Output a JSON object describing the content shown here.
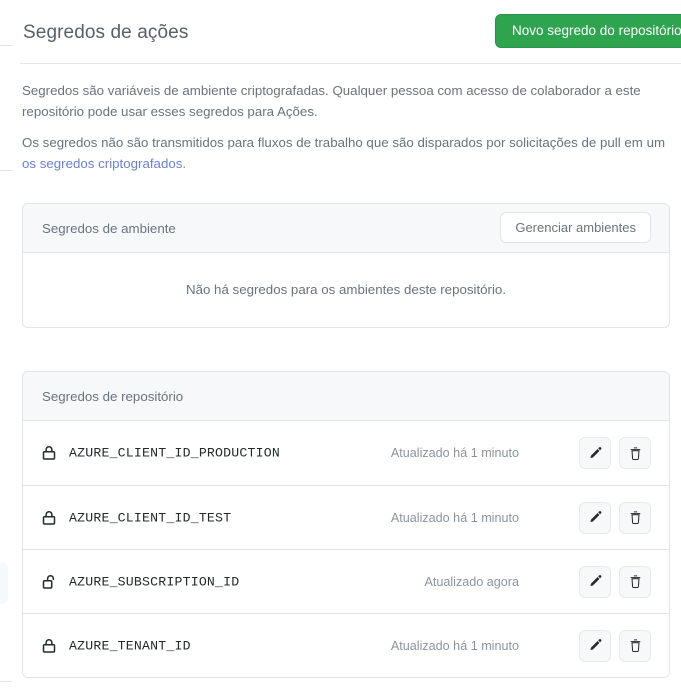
{
  "header": {
    "title": "Segredos de ações",
    "new_secret_button": "Novo segredo do repositório"
  },
  "description": {
    "paragraph1": "Segredos são variáveis de ambiente criptografadas. Qualquer pessoa com acesso de colaborador a este repositório pode usar esses segredos para Ações.",
    "paragraph2": "Os segredos não são transmitidos para fluxos de trabalho que são disparados por solicitações de pull em um ",
    "link_text": "os segredos criptografados."
  },
  "environment_secrets": {
    "title": "Segredos de ambiente",
    "manage_button": "Gerenciar ambientes",
    "empty_message": "Não há segredos para os ambientes deste repositório."
  },
  "repository_secrets": {
    "title": "Segredos de repositório",
    "rows": [
      {
        "icon": "lock-closed-icon",
        "name": "AZURE_CLIENT_ID_PRODUCTION",
        "updated": "Atualizado há 1 minuto"
      },
      {
        "icon": "lock-closed-icon",
        "name": "AZURE_CLIENT_ID_TEST",
        "updated": "Atualizado há 1 minuto"
      },
      {
        "icon": "lock-open-icon",
        "name": "AZURE_SUBSCRIPTION_ID",
        "updated": "Atualizado agora"
      },
      {
        "icon": "lock-closed-icon",
        "name": "AZURE_TENANT_ID",
        "updated": "Atualizado há 1 minuto"
      }
    ]
  },
  "colors": {
    "accent_green": "#2ea44f",
    "link_blue": "#6b7fd7",
    "border": "#e1e4e8",
    "muted_text": "#6a737d",
    "name_text": "#24292e"
  }
}
